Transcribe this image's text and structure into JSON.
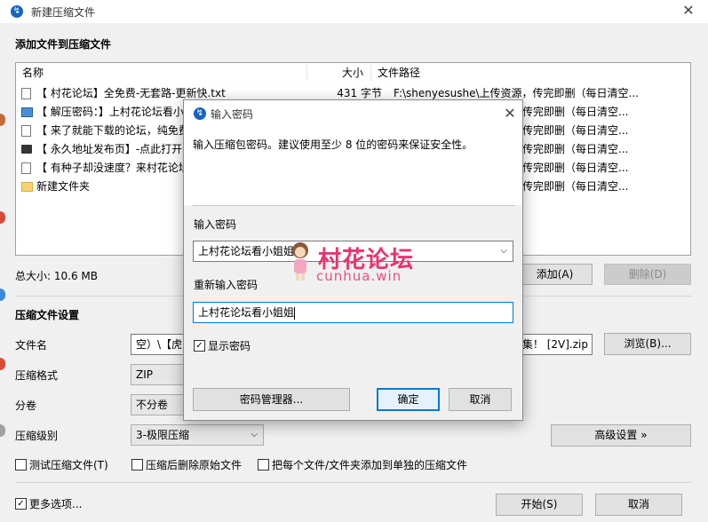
{
  "window": {
    "title": "新建压缩文件",
    "close": "✕"
  },
  "section_add": "添加文件到压缩文件",
  "list": {
    "headers": {
      "name": "名称",
      "size": "大小",
      "path": "文件路径"
    },
    "rows": [
      {
        "icon": "document-icon",
        "name": "【 村花论坛】全免费-无套路-更新快.txt",
        "size": "431 字节",
        "path": "F:\\shenyesushe\\上传资源，传完即删（每日清空..."
      },
      {
        "icon": "image-icon",
        "name": "【 解压密码：】上村花论坛看小",
        "size": "",
        "path": "传完即删（每日清空..."
      },
      {
        "icon": "document-icon",
        "name": "【 来了就能下载的论坛，纯免费",
        "size": "",
        "path": "传完即删（每日清空..."
      },
      {
        "icon": "computer-icon",
        "name": "【 永久地址发布页】-点此打开",
        "size": "",
        "path": "传完即删（每日清空..."
      },
      {
        "icon": "document-icon",
        "name": "【 有种子却没速度？来村花论坛",
        "size": "",
        "path": "传完即删（每日清空..."
      },
      {
        "icon": "folder-icon",
        "name": "新建文件夹",
        "size": "",
        "path": "传完即删（每日清空..."
      }
    ]
  },
  "total_size": "总大小: 10.6 MB",
  "add_button": "添加(A)",
  "delete_button": "删除(D)",
  "settings_title": "压缩文件设置",
  "filename_label": "文件名",
  "filename_value_left": "空）\\【虎",
  "filename_value_right": "集！ [2V].zip",
  "browse_button": "浏览(B)...",
  "format_label": "压缩格式",
  "format_value": "ZIP",
  "volume_label": "分卷",
  "volume_value": "不分卷",
  "level_label": "压缩级别",
  "level_value": "3-极限压缩",
  "advanced_button": "高级设置 »",
  "test_checkbox": "测试压缩文件(T)",
  "delete_after_checkbox": "压缩后删除原始文件",
  "separate_checkbox": "把每个文件/文件夹添加到单独的压缩文件",
  "more_options": "更多选项...",
  "start_button": "开始(S)",
  "cancel_button": "取消",
  "dialog": {
    "title": "输入密码",
    "close": "✕",
    "hint": "输入压缩包密码。建议使用至少 8 位的密码来保证安全性。",
    "password_label": "输入密码",
    "password_value": "上村花论坛看小姐姐",
    "confirm_label": "重新输入密码",
    "confirm_value": "上村花论坛看小姐姐",
    "show_password": "显示密码",
    "manager_button": "密码管理器...",
    "ok_button": "确定",
    "cancel_button": "取消"
  },
  "watermark": {
    "main": "村花论坛",
    "sub": "cunhua.win"
  },
  "colors": {
    "accent": "#0078d7",
    "watermark": "#e8356d",
    "folder": "#f6d36a"
  }
}
